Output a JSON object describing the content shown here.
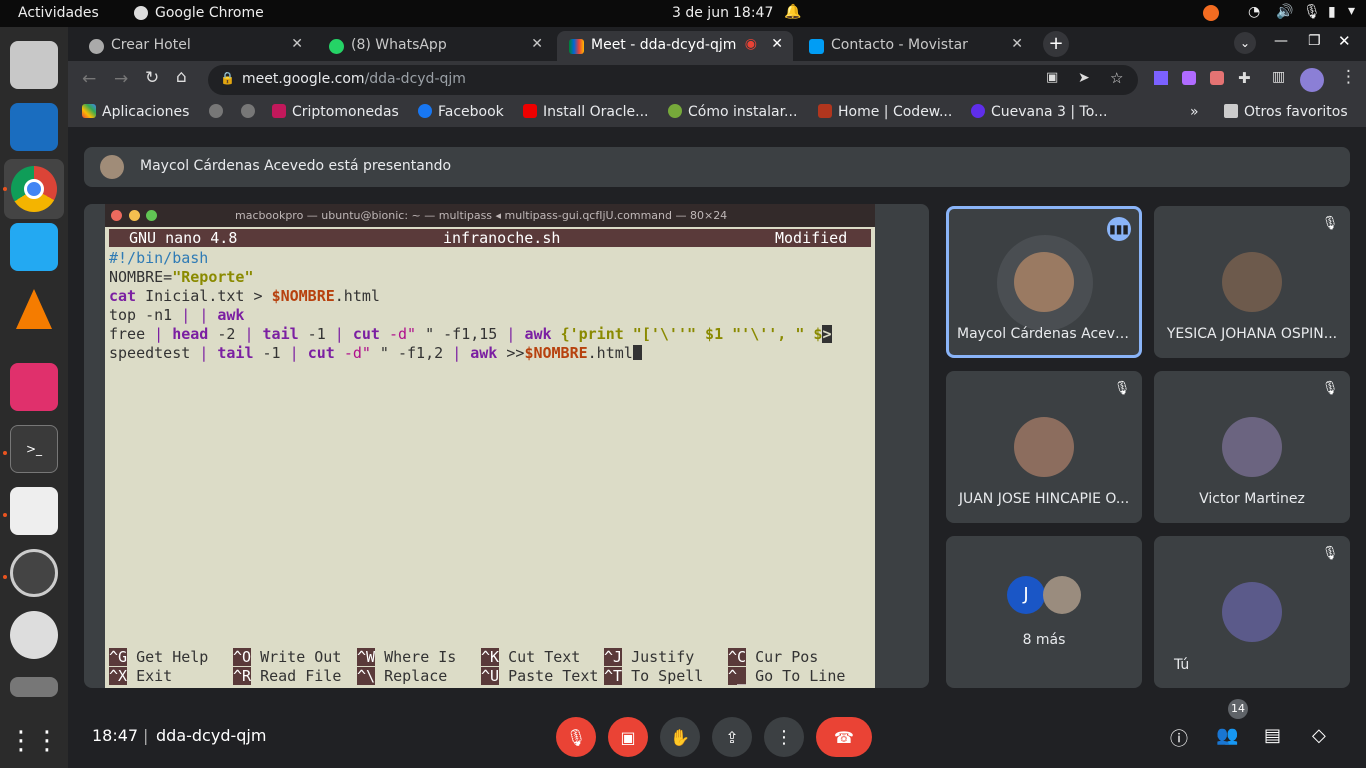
{
  "os": {
    "activities": "Actividades",
    "app": "Google Chrome",
    "date": "3 de jun",
    "time": "18:47"
  },
  "tabs": [
    {
      "label": "Crear Hotel"
    },
    {
      "label": "(8) WhatsApp"
    },
    {
      "label": "Meet - dda-dcyd-qjm"
    },
    {
      "label": "Contacto - Movistar"
    }
  ],
  "toolbar": {
    "url_host": "meet.google.com",
    "url_path": "/dda-dcyd-qjm"
  },
  "bookmarks": [
    "Aplicaciones",
    "Criptomonedas",
    "Facebook",
    "Install Oracle...",
    "Cómo instalar...",
    "Home | Codew...",
    "Cuevana 3 | To...",
    "Otros favoritos"
  ],
  "meet": {
    "presenting": "Maycol Cárdenas Acevedo está presentando",
    "time": "18:47",
    "code": "dda-dcyd-qjm",
    "people_count": "14",
    "tiles": [
      {
        "name": "Maycol Cárdenas Aceve..."
      },
      {
        "name": "YESICA JOHANA OSPIN..."
      },
      {
        "name": "JUAN JOSE HINCAPIE O..."
      },
      {
        "name": "Victor Martinez"
      },
      {
        "name": "8 más",
        "initial": "J"
      },
      {
        "name": "Tú"
      }
    ]
  },
  "terminal": {
    "title": "macbookpro — ubuntu@bionic: ~ — multipass ◂ multipass-gui.qcfIjU.command — 80×24",
    "nano_version": "GNU nano 4.8",
    "file": "infranoche.sh",
    "status": "Modified",
    "keys": [
      [
        "^G",
        "Get Help",
        "^O",
        "Write Out",
        "^W",
        "Where Is",
        "^K",
        "Cut Text",
        "^J",
        "Justify",
        "^C",
        "Cur Pos"
      ],
      [
        "^X",
        "Exit",
        "^R",
        "Read File",
        "^\\",
        "Replace",
        "^U",
        "Paste Text",
        "^T",
        "To Spell",
        "^_",
        "Go To Line"
      ]
    ]
  }
}
